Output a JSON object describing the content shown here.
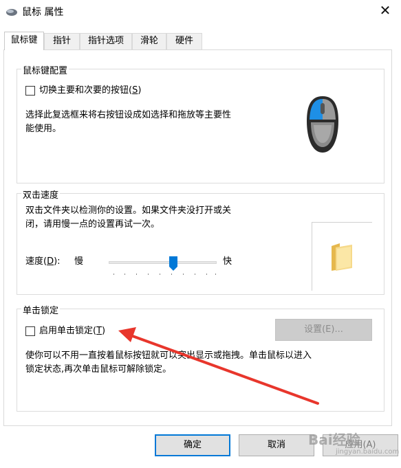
{
  "window": {
    "title": "鼠标 属性",
    "close_glyph": "✕"
  },
  "tabs": [
    {
      "label": "鼠标键",
      "active": true
    },
    {
      "label": "指针",
      "active": false
    },
    {
      "label": "指针选项",
      "active": false
    },
    {
      "label": "滑轮",
      "active": false
    },
    {
      "label": "硬件",
      "active": false
    }
  ],
  "button_config": {
    "group_title": "鼠标键配置",
    "checkbox_label_pre": "切换主要和次要的按钮(",
    "checkbox_label_key": "S",
    "checkbox_label_post": ")",
    "checked": false,
    "description_line1": "选择此复选框来将右按钮设成如选择和拖放等主要性",
    "description_line2": "能使用。"
  },
  "double_click": {
    "group_title": "双击速度",
    "description_line1": "双击文件夹以检测你的设置。如果文件夹没打开或关",
    "description_line2": "闭，请用慢一点的设置再试一次。",
    "speed_label_pre": "速度(",
    "speed_label_key": "D",
    "speed_label_post": "):",
    "slow_label": "慢",
    "fast_label": "快",
    "slider_value": 0.6
  },
  "click_lock": {
    "group_title": "单击锁定",
    "checkbox_label_pre": "启用单击锁定(",
    "checkbox_label_key": "T",
    "checkbox_label_post": ")",
    "checked": false,
    "settings_button": "设置(E)...",
    "description_line1": "使你可以不用一直按着鼠标按钮就可以突出显示或拖拽。单击鼠标以进入",
    "description_line2": "锁定状态,再次单击鼠标可解除锁定。"
  },
  "footer": {
    "ok_label": "确定",
    "cancel_label": "取消",
    "apply_label": "应用(A)"
  },
  "watermark": {
    "brand": "Bai经验",
    "url": "jingyan.baidu.com"
  },
  "colors": {
    "accent": "#0078d7",
    "arrow": "#e8362c",
    "mouse_blue": "#1e8fe6"
  }
}
